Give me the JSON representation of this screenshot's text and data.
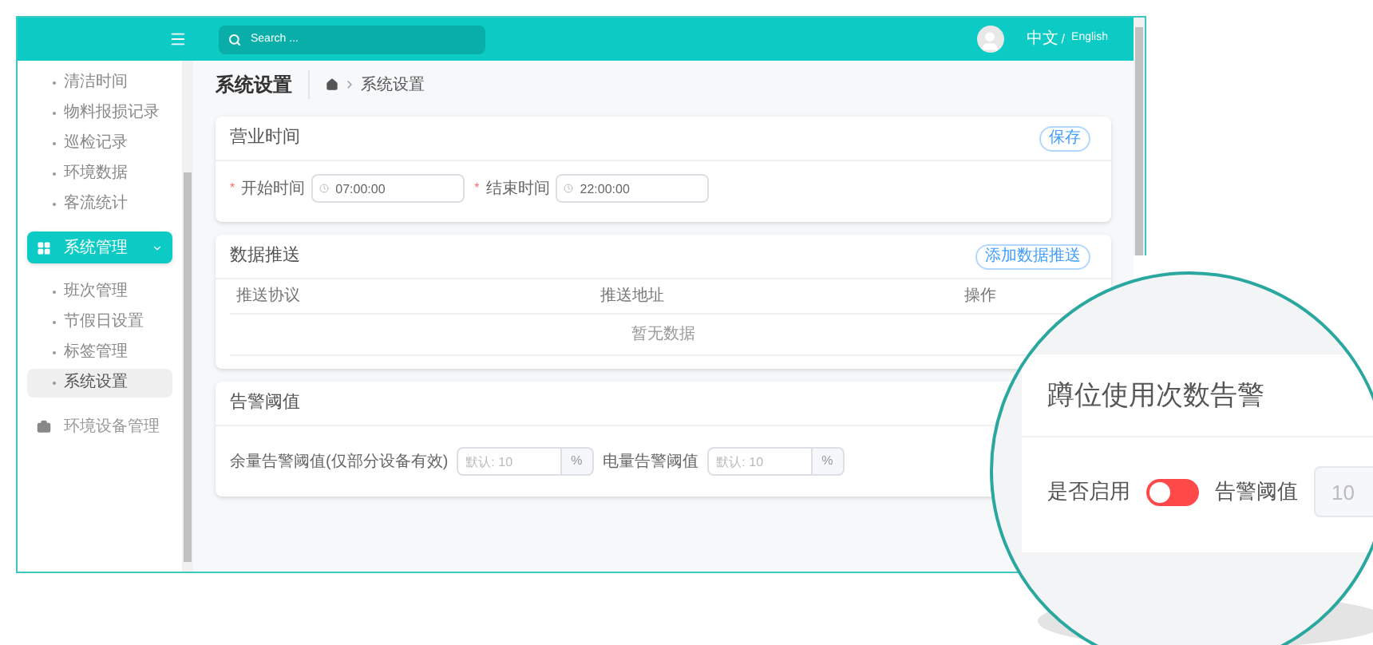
{
  "header": {
    "search_placeholder": "Search ...",
    "lang_zh": "中文",
    "lang_separator": "/",
    "lang_en": "English"
  },
  "sidebar": {
    "items": [
      {
        "label": "清洁时间",
        "kind": "sub",
        "selected": false
      },
      {
        "label": "物料报损记录",
        "kind": "sub",
        "selected": false
      },
      {
        "label": "巡检记录",
        "kind": "sub",
        "selected": false
      },
      {
        "label": "环境数据",
        "kind": "sub",
        "selected": false
      },
      {
        "label": "客流统计",
        "kind": "sub",
        "selected": false
      },
      {
        "label": "系统管理",
        "kind": "group",
        "selected": true,
        "expanded": true
      },
      {
        "label": "班次管理",
        "kind": "sub",
        "selected": false
      },
      {
        "label": "节假日设置",
        "kind": "sub",
        "selected": false
      },
      {
        "label": "标签管理",
        "kind": "sub",
        "selected": false
      },
      {
        "label": "系统设置",
        "kind": "sub",
        "selected": true
      },
      {
        "label": "环境设备管理",
        "kind": "group",
        "selected": false,
        "expanded": false
      }
    ]
  },
  "page": {
    "title": "系统设置",
    "breadcrumb": "系统设置"
  },
  "business_hours": {
    "title": "营业时间",
    "button": "保存",
    "fields": [
      {
        "required_mark": "*",
        "label": "开始时间",
        "value": "07:00:00"
      },
      {
        "required_mark": "*",
        "label": "结束时间",
        "value": "22:00:00"
      }
    ]
  },
  "data_push": {
    "title": "数据推送",
    "button": "添加数据推送",
    "columns": [
      "推送协议",
      "推送地址",
      "操作"
    ],
    "empty_text": "暂无数据"
  },
  "alarm": {
    "title": "告警阈值",
    "fields": [
      {
        "label": "余量告警阈值(仅部分设备有效)",
        "placeholder": "默认: 10",
        "unit": "%"
      },
      {
        "label": "电量告警阈值",
        "placeholder": "默认: 10",
        "unit": "%"
      }
    ]
  },
  "magnifier": {
    "title": "蹲位使用次数告警",
    "toggle_label": "是否启用",
    "on": false,
    "threshold_label": "告警阈值",
    "threshold_value": "10"
  }
}
